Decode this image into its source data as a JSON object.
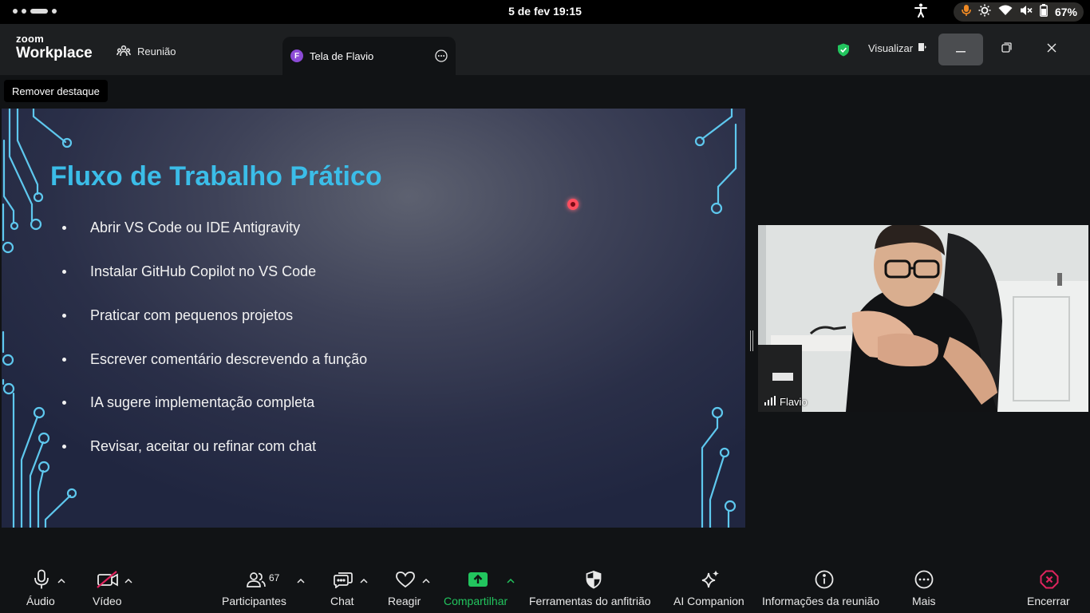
{
  "status_bar": {
    "clock": "5 de fev  19:15",
    "battery": "67%"
  },
  "window": {
    "logo_line1": "zoom",
    "logo_line2": "Workplace",
    "tab_meeting": "Reunião",
    "tab_screen": "Tela de Flavio",
    "tab_screen_avatar": "F",
    "view_label": "Visualizar"
  },
  "remove_highlight": "Remover destaque",
  "slide": {
    "title": "Fluxo de Trabalho Prático",
    "bullets": [
      "Abrir VS Code ou IDE Antigravity",
      "Instalar GitHub Copilot no VS Code",
      "Praticar com pequenos projetos",
      "Escrever comentário descrevendo a função",
      "IA sugere implementação completa",
      "Revisar, aceitar ou refinar com chat"
    ],
    "title_color": "#3bbde8",
    "circuit_color": "#5ec8ee"
  },
  "video": {
    "participant_name": "Flavio"
  },
  "toolbar": {
    "audio": "Áudio",
    "video": "Vídeo",
    "participants": "Participantes",
    "participants_count": "67",
    "chat": "Chat",
    "react": "Reagir",
    "share": "Compartilhar",
    "host_tools": "Ferramentas do anfitrião",
    "ai_companion": "AI Companion",
    "meeting_info": "Informações da reunião",
    "more": "Mais",
    "end": "Encerrar",
    "share_color": "#22c55e",
    "end_color": "#e0245e"
  }
}
